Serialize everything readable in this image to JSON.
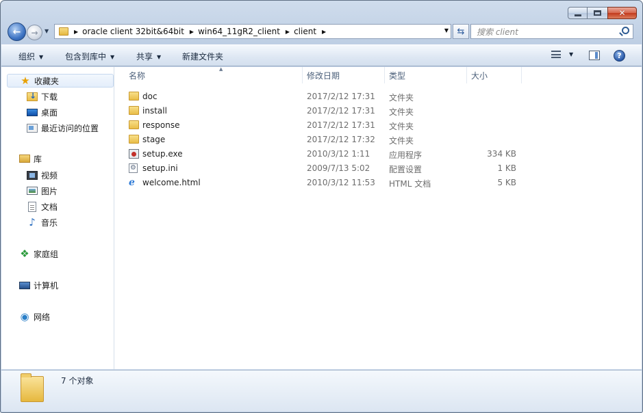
{
  "window": {
    "caption": {
      "minimize": "–",
      "maximize": "□",
      "close": "✕"
    }
  },
  "address": {
    "crumbs": [
      "oracle client 32bit&64bit",
      "win64_11gR2_client",
      "client"
    ]
  },
  "search": {
    "placeholder": "搜索 client"
  },
  "toolbar": {
    "organize": "组织",
    "include_in_library": "包含到库中",
    "share": "共享",
    "new_folder": "新建文件夹",
    "help": "?"
  },
  "nav": {
    "favorites": "收藏夹",
    "downloads": "下载",
    "desktop": "桌面",
    "recent": "最近访问的位置",
    "libraries": "库",
    "videos": "视频",
    "pictures": "图片",
    "documents": "文档",
    "music": "音乐",
    "homegroup": "家庭组",
    "computer": "计算机",
    "network": "网络"
  },
  "columns": {
    "name": "名称",
    "modified": "修改日期",
    "type": "类型",
    "size": "大小"
  },
  "files": [
    {
      "name": "doc",
      "modified": "2017/2/12 17:31",
      "type": "文件夹",
      "size": "",
      "icon": "folder"
    },
    {
      "name": "install",
      "modified": "2017/2/12 17:31",
      "type": "文件夹",
      "size": "",
      "icon": "folder"
    },
    {
      "name": "response",
      "modified": "2017/2/12 17:31",
      "type": "文件夹",
      "size": "",
      "icon": "folder"
    },
    {
      "name": "stage",
      "modified": "2017/2/12 17:32",
      "type": "文件夹",
      "size": "",
      "icon": "folder"
    },
    {
      "name": "setup.exe",
      "modified": "2010/3/12 1:11",
      "type": "应用程序",
      "size": "334 KB",
      "icon": "exe"
    },
    {
      "name": "setup.ini",
      "modified": "2009/7/13 5:02",
      "type": "配置设置",
      "size": "1 KB",
      "icon": "ini"
    },
    {
      "name": "welcome.html",
      "modified": "2010/3/12 11:53",
      "type": "HTML 文档",
      "size": "5 KB",
      "icon": "html"
    }
  ],
  "status": {
    "count": "7 个对象"
  }
}
